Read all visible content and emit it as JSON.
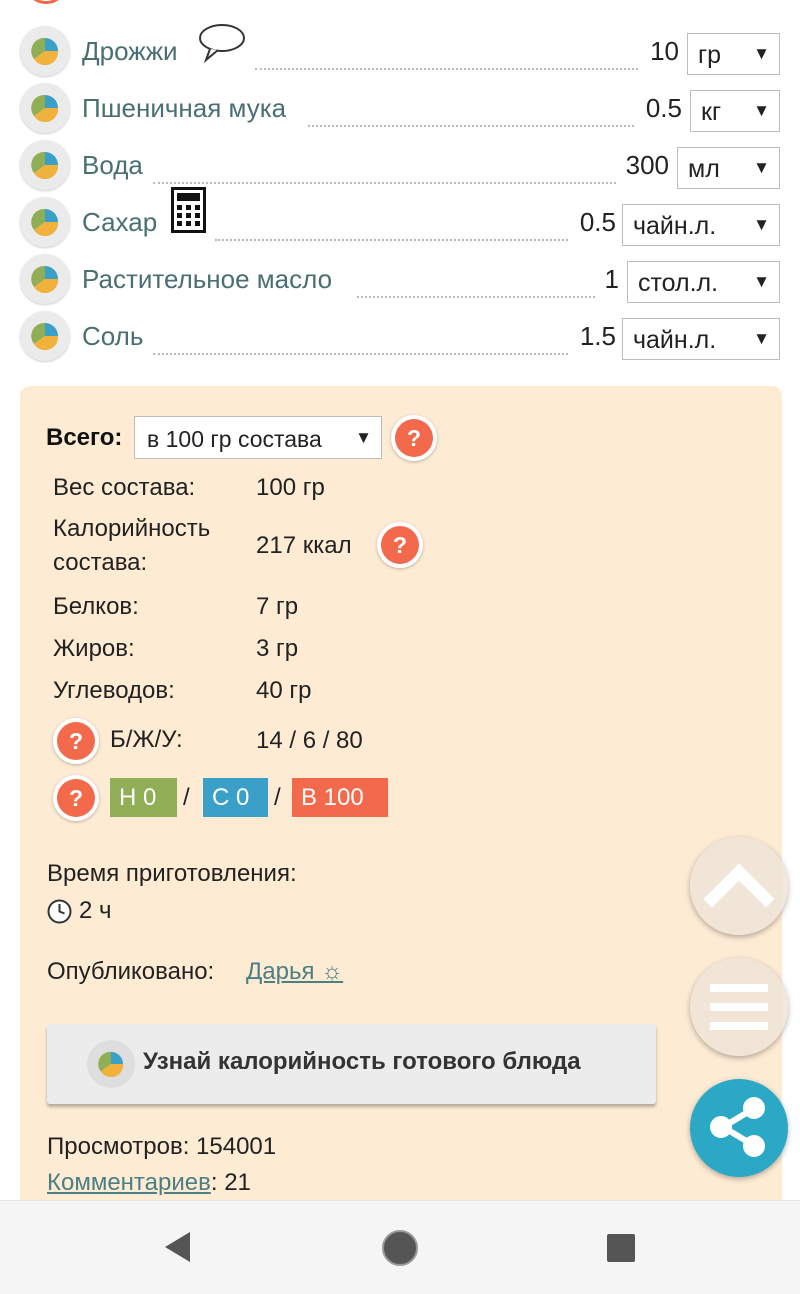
{
  "ingredients": [
    {
      "name": "Дрожжи",
      "qty": "10",
      "unit": "гр"
    },
    {
      "name": "Пшеничная мука",
      "qty": "0.5",
      "unit": "кг"
    },
    {
      "name": "Вода",
      "qty": "300",
      "unit": "мл"
    },
    {
      "name": "Сахар",
      "qty": "0.5",
      "unit": "чайн.л."
    },
    {
      "name": "Растительное масло",
      "qty": "1",
      "unit": "стол.л."
    },
    {
      "name": "Соль",
      "qty": "1.5",
      "unit": "чайн.л."
    }
  ],
  "summary": {
    "total_label": "Всего:",
    "basis_select": "в 100 гр состава",
    "help_glyph": "?",
    "rows": [
      {
        "label": "Вес состава:",
        "value": "100 гр"
      },
      {
        "label": "Калорийность состава:",
        "label_line1": "Калорийность",
        "label_line2": "состава:",
        "value": "217 ккал"
      },
      {
        "label": "Белков:",
        "value": "7 гр"
      },
      {
        "label": "Жиров:",
        "value": "3 гр"
      },
      {
        "label": "Углеводов:",
        "value": "40 гр"
      }
    ],
    "bju_label": "Б/Ж/У:",
    "bju_value": "14 / 6 / 80",
    "badges": {
      "n": "Н  0",
      "c": "С  0",
      "b": "В  100",
      "separator": "/"
    },
    "prep_time_label": "Время приготовления:",
    "prep_time_value": "2 ч",
    "published_label": "Опубликовано:",
    "author": "Дарья ☼",
    "calorie_button": "Узнай калорийность готового блюда",
    "views_label": "Просмотров: 154001",
    "comments_link": "Комментариев",
    "comments_count": ": 21"
  },
  "colors": {
    "accent_orange": "#f26a4b",
    "panel_bg": "#fdebd4",
    "link_teal": "#4a7f84",
    "badge_green": "#8fae55",
    "badge_blue": "#3aa0c8",
    "share_blue": "#2aa8c6"
  },
  "icons": {
    "ingredient": "pie-chart-icon",
    "comment": "speech-bubble-icon",
    "calculator": "calculator-icon",
    "help": "question-icon",
    "clock": "clock-icon",
    "scroll_up": "chevron-up-icon",
    "menu": "hamburger-menu-icon",
    "share": "share-icon",
    "nav": [
      "back-triangle-icon",
      "home-circle-icon",
      "recents-square-icon"
    ]
  }
}
